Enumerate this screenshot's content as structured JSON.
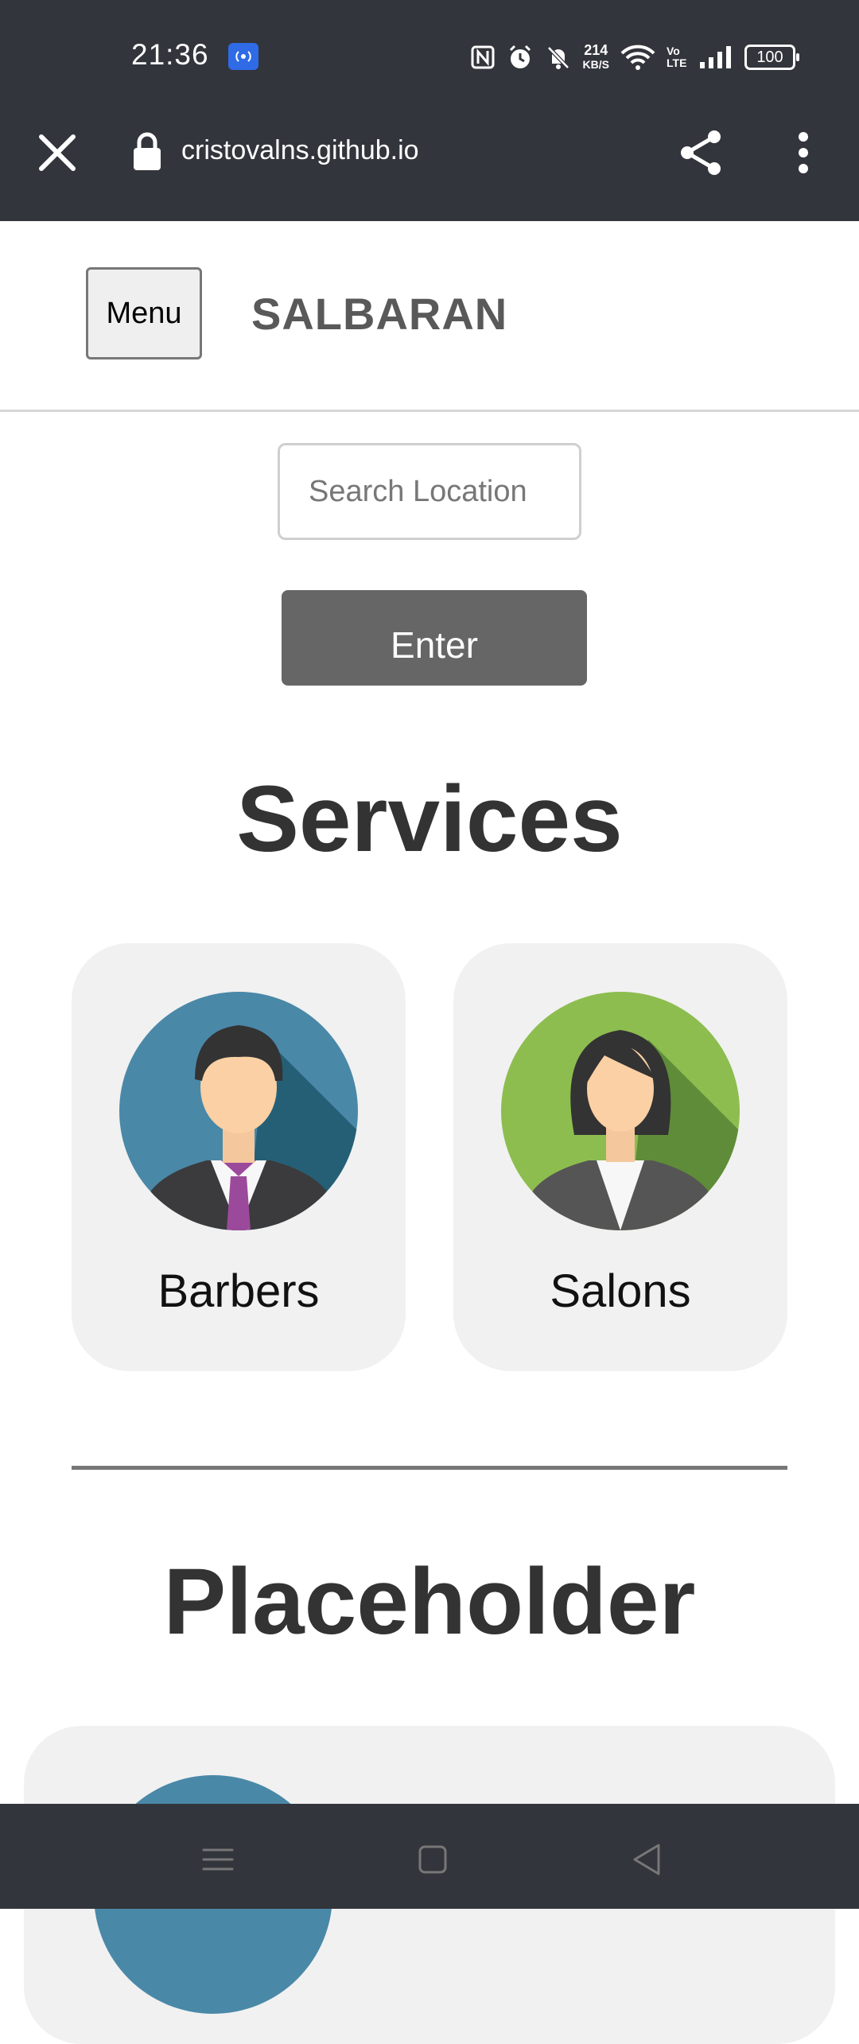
{
  "status_bar": {
    "time": "21:36",
    "net_speed_value": "214",
    "net_speed_unit": "KB/S",
    "volte_label": "Vo LTE",
    "battery": "100"
  },
  "browser": {
    "url": "cristovalns.github.io"
  },
  "header": {
    "menu_label": "Menu",
    "brand": "SALBARAN"
  },
  "search": {
    "placeholder": "Search Location",
    "enter_label": "Enter"
  },
  "services": {
    "title": "Services",
    "cards": [
      {
        "label": "Barbers"
      },
      {
        "label": "Salons"
      }
    ]
  },
  "placeholder_section": {
    "title": "Placeholder"
  },
  "colors": {
    "chrome": "#33353c",
    "enter_button": "#666666",
    "card_bg": "#f1f1f1",
    "barber_avatar_bg": "#4a88a8",
    "salon_avatar_bg": "#8dbd4f"
  }
}
